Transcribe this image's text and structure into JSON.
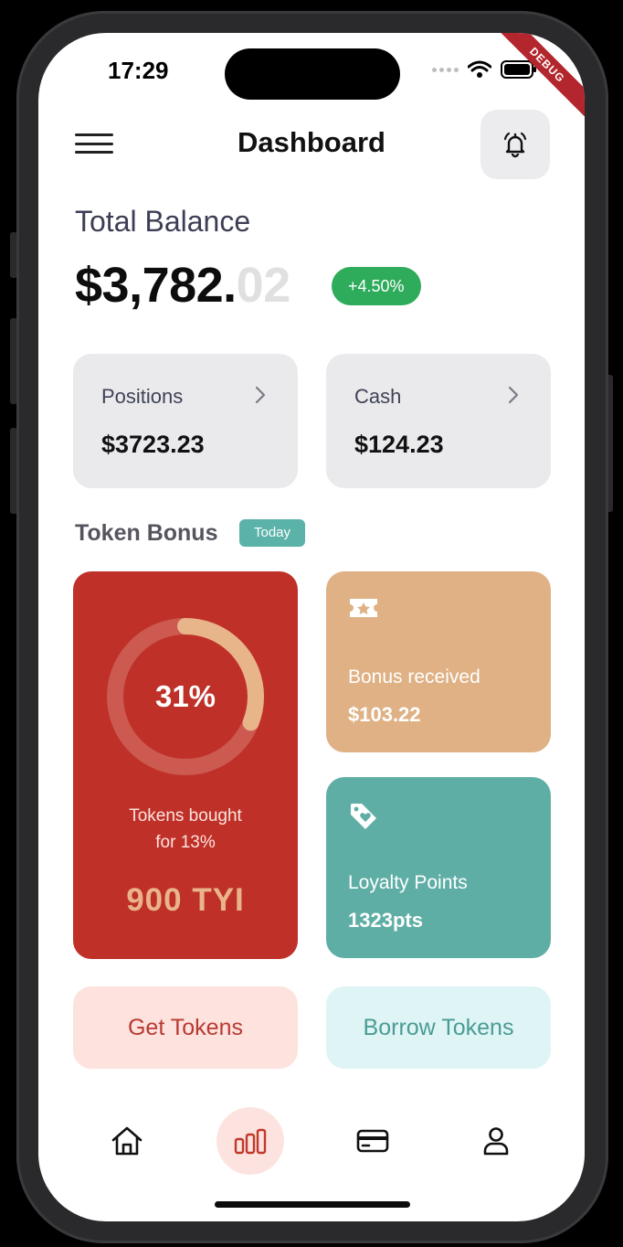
{
  "status_bar": {
    "time": "17:29",
    "debug_label": "DEBUG"
  },
  "header": {
    "title": "Dashboard"
  },
  "balance": {
    "label": "Total Balance",
    "amount_main": "$3,782.",
    "amount_cents": "02",
    "change": "+4.50%"
  },
  "summary": [
    {
      "label": "Positions",
      "value": "$3723.23"
    },
    {
      "label": "Cash",
      "value": "$124.23"
    }
  ],
  "token_bonus": {
    "title": "Token Bonus",
    "badge": "Today",
    "progress_percent": 31,
    "progress_label": "31%",
    "caption_line1": "Tokens bought",
    "caption_line2": "for 13%",
    "amount": "900 TYI",
    "bonus_label": "Bonus received",
    "bonus_value": "$103.22",
    "loyalty_label": "Loyalty Points",
    "loyalty_value": "1323pts"
  },
  "actions": {
    "get_label": "Get Tokens",
    "borrow_label": "Borrow Tokens"
  },
  "nav": [
    "home-icon",
    "chart-icon",
    "card-icon",
    "profile-icon"
  ],
  "colors": {
    "accent_red": "#bf3128",
    "bonus_tan": "#dfb184",
    "loyalty_teal": "#5faea6",
    "positive_green": "#2eab5b"
  }
}
